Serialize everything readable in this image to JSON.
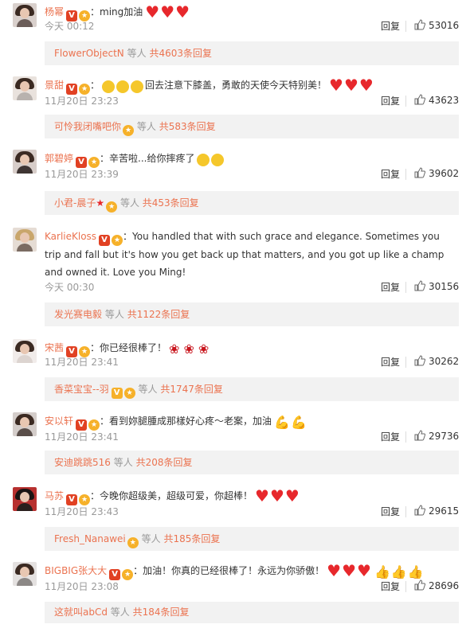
{
  "reply_label": "回复",
  "others_label": "等人",
  "comments": [
    {
      "user": "杨幂",
      "text": "：ming加油",
      "emoji": "hearts3",
      "time": "今天 00:12",
      "likes": "53016",
      "reply_name": "FlowerObjectN",
      "reply_count": "共4603条回复"
    },
    {
      "user": "景甜",
      "text": "回去注意下膝盖，勇敢的天使今天特别美！",
      "emoji": "smiles3-hearts3",
      "time": "11月20日 23:23",
      "likes": "43623",
      "reply_name": "可怜我闭嘴吧你",
      "reply_count": "共583条回复"
    },
    {
      "user": "郭碧婷",
      "text": "：辛苦啦...给你摔疼了",
      "emoji": "smiles2",
      "time": "11月20日 23:39",
      "likes": "39602",
      "reply_name": "小君-晨子",
      "reply_count": "共453条回复"
    },
    {
      "user": "KarlieKloss",
      "text": "：You handled that with such grace and elegance. Sometimes you trip and fall but it's how you get back up that matters, and you got up like a champ and owned it. Love you Ming!",
      "emoji": "",
      "time": "今天 00:30",
      "likes": "30156",
      "reply_name": "发光赛电毅",
      "reply_count": "共1122条回复"
    },
    {
      "user": "宋茜",
      "text": "：你已经很棒了！",
      "emoji": "roses3",
      "time": "11月20日 23:41",
      "likes": "30262",
      "reply_name": "香菜宝宝--羽",
      "reply_count": "共1747条回复"
    },
    {
      "user": "安以轩",
      "text": "：看到妳腿腫成那樣好心疼～老案，加油",
      "emoji": "muscle2",
      "time": "11月20日 23:41",
      "likes": "29736",
      "reply_name": "安迪跳跳516",
      "reply_count": "共208条回复"
    },
    {
      "user": "马苏",
      "text": "：今晚你超级美，超级可爱，你超棒！",
      "emoji": "hearts3",
      "time": "11月20日 23:43",
      "likes": "29615",
      "reply_name": "Fresh_Nanawei",
      "reply_count": "共185条回复"
    },
    {
      "user": "BIGBIG张大大",
      "text": "：加油！你真的已经很棒了！永远为你骄傲！",
      "emoji": "hearts3-thumbs3",
      "time": "11月20日 23:08",
      "likes": "28696",
      "reply_name": "这就叫abCd",
      "reply_count": "共184条回复"
    }
  ],
  "colors": {
    "username": "#eb7350",
    "heart": "#e7282c",
    "reply_bg": "#f2f2f2",
    "meta": "#999999"
  }
}
